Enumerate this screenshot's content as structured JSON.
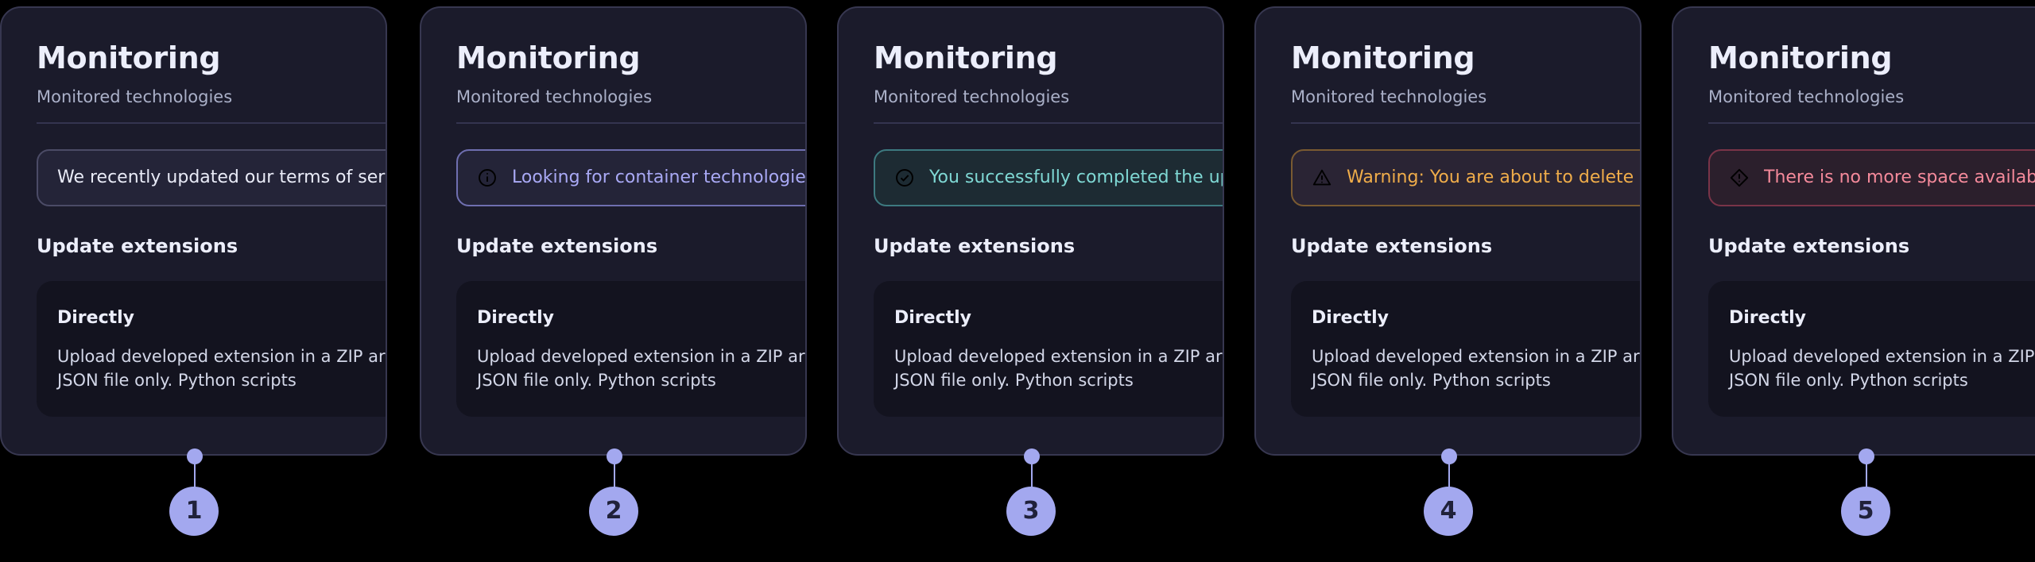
{
  "cards": [
    {
      "title": "Monitoring",
      "subtitle": "Monitored technologies",
      "alert": {
        "variant": "neutral",
        "icon": "none",
        "text": "We recently updated our terms of service"
      },
      "section_title": "Update extensions",
      "sub_title": "Directly",
      "sub_body": "Upload developed extension in a ZIP archive that include JSON file only. Python scripts",
      "marker": "1"
    },
    {
      "title": "Monitoring",
      "subtitle": "Monitored technologies",
      "alert": {
        "variant": "info",
        "icon": "info-circle-icon",
        "text": "Looking for container technologies?"
      },
      "section_title": "Update extensions",
      "sub_title": "Directly",
      "sub_body": "Upload developed extension in a ZIP archive that include JSON file only. Python scripts",
      "marker": "2"
    },
    {
      "title": "Monitoring",
      "subtitle": "Monitored technologies",
      "alert": {
        "variant": "success",
        "icon": "check-circle-icon",
        "text": "You successfully completed the update"
      },
      "section_title": "Update extensions",
      "sub_title": "Directly",
      "sub_body": "Upload developed extension in a ZIP archive that include JSON file only. Python scripts",
      "marker": "3"
    },
    {
      "title": "Monitoring",
      "subtitle": "Monitored technologies",
      "alert": {
        "variant": "warning",
        "icon": "warning-triangle-icon",
        "text": "Warning: You are about to delete data"
      },
      "section_title": "Update extensions",
      "sub_title": "Directly",
      "sub_body": "Upload developed extension in a ZIP archive that include JSON file only. Python scripts",
      "marker": "4"
    },
    {
      "title": "Monitoring",
      "subtitle": "Monitored technologies",
      "alert": {
        "variant": "error",
        "icon": "error-diamond-icon",
        "text": "There is no more space available"
      },
      "section_title": "Update extensions",
      "sub_title": "Directly",
      "sub_body": "Upload developed extension in a ZIP archive that include JSON file only. Python scripts",
      "marker": "5"
    }
  ],
  "colors": {
    "page_background": "#000000",
    "card_background": "#1b1b2b",
    "card_border": "#373750",
    "subcard_background": "#13131f",
    "title_text": "#eceefb",
    "subtitle_text": "#aab0c8",
    "marker_accent": "#a3a8ef",
    "alert_neutral": "#e9ebf7",
    "alert_info": "#a9a9f5",
    "alert_success": "#7fd8d4",
    "alert_warning": "#f0ad4a",
    "alert_error": "#f58a9b"
  },
  "layout": {
    "card_left_positions": [
      0,
      528,
      1053,
      1578,
      2103
    ],
    "marker_left_positions": [
      213,
      741,
      1266,
      1791,
      2316
    ]
  }
}
